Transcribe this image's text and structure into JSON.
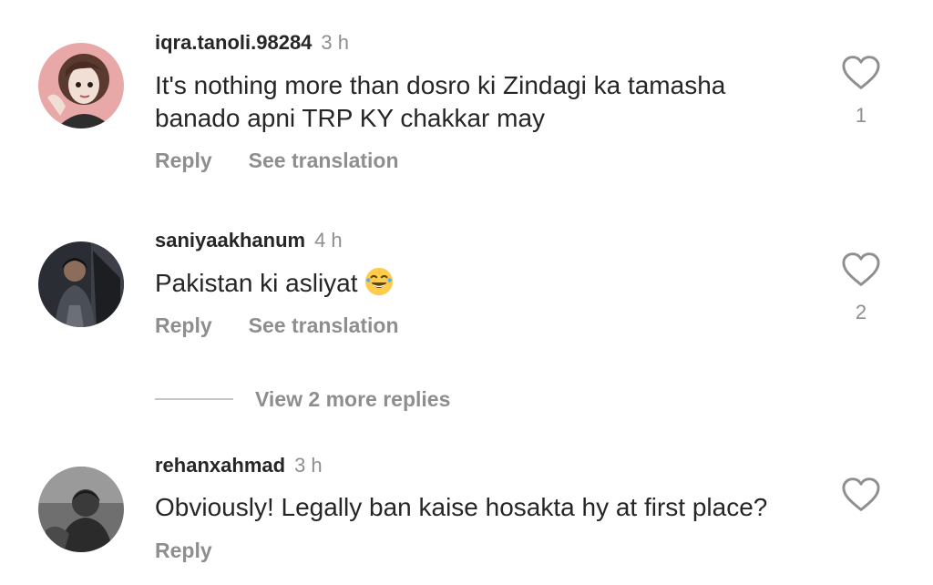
{
  "comments": [
    {
      "username": "iqra.tanoli.98284",
      "time": "3 h",
      "text_lines": [
        "It's nothing more than dosro ki Zindagi ka tamasha",
        "banado apni TRP KY chakkar may"
      ],
      "reply_label": "Reply",
      "translate_label": "See translation",
      "likes": "1"
    },
    {
      "username": "saniyaakhanum",
      "time": "4 h",
      "text": "Pakistan ki asliyat",
      "reply_label": "Reply",
      "translate_label": "See translation",
      "likes": "2"
    },
    {
      "username": "rehanxahmad",
      "time": "3 h",
      "text": "Obviously! Legally ban kaise hosakta hy at first place?",
      "reply_label": "Reply"
    }
  ],
  "view_more_replies": "View 2 more replies",
  "icons": {
    "like": "heart-outline-icon",
    "emoji": "face-with-tears-of-joy"
  },
  "colors": {
    "primary_text": "#262626",
    "secondary_text": "#8e8e8e",
    "divider": "#c7c7c7"
  }
}
